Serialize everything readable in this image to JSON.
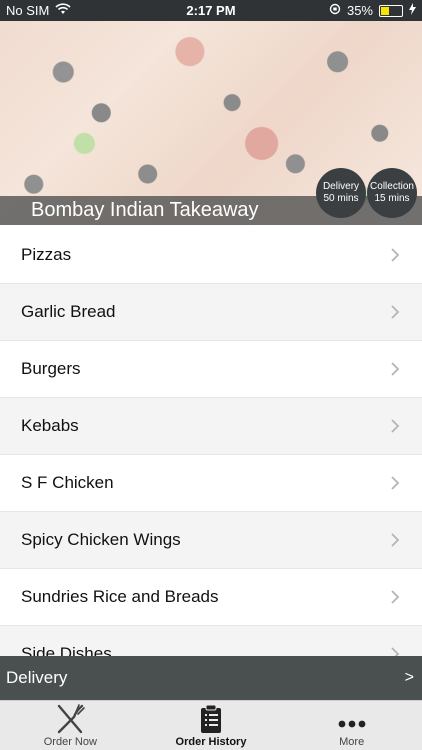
{
  "status_bar": {
    "carrier": "No SIM",
    "time": "2:17 PM",
    "battery": "35%",
    "battery_level": 0.35
  },
  "restaurant": {
    "name": "Bombay Indian Takeaway",
    "delivery_badge": {
      "line1": "Delivery",
      "line2": "50 mins"
    },
    "collection_badge": {
      "line1": "Collection",
      "line2": "15 mins"
    }
  },
  "menu": {
    "items": [
      {
        "label": "Pizzas"
      },
      {
        "label": "Garlic Bread"
      },
      {
        "label": "Burgers"
      },
      {
        "label": "Kebabs"
      },
      {
        "label": "S F Chicken"
      },
      {
        "label": "Spicy Chicken Wings"
      },
      {
        "label": "Sundries Rice and Breads"
      },
      {
        "label": "Side Dishes"
      }
    ]
  },
  "delivery_bar": {
    "label": "Delivery",
    "arrow": ">"
  },
  "tabs": [
    {
      "label": "Order Now",
      "icon": "fork-knife-icon"
    },
    {
      "label": "Order History",
      "icon": "clipboard-icon"
    },
    {
      "label": "More",
      "icon": "more-dots-icon"
    }
  ],
  "colors": {
    "accent_bar": "#4a4f4f",
    "status_bar": "#2f3335",
    "badge": "#3b3f41"
  }
}
